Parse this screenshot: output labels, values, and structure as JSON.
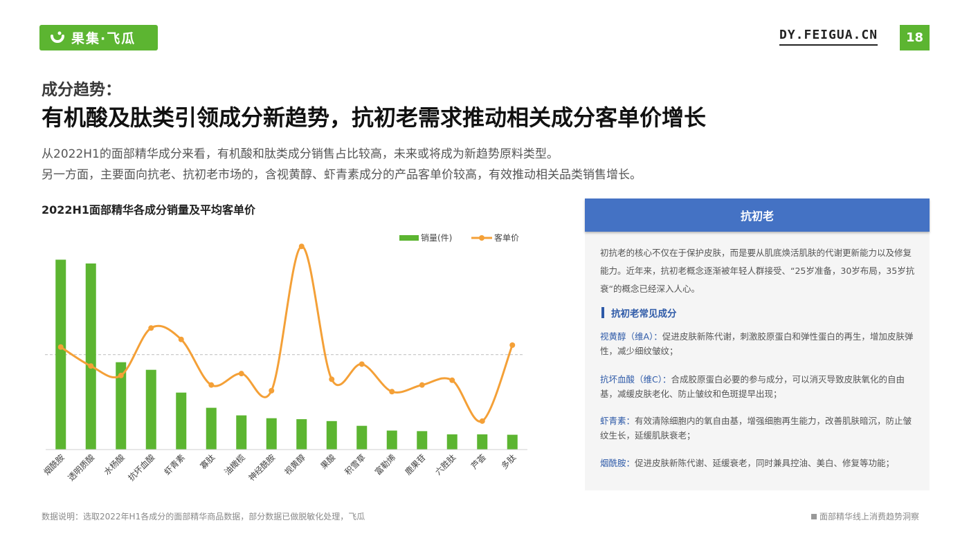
{
  "header": {
    "logo_text": "果集·飞瓜",
    "site_url": "DY.FEIGUA.CN",
    "page_number": "18",
    "brand_color": "#5cb531"
  },
  "heading": {
    "label": "成分趋势：",
    "title": "有机酸及肽类引领成分新趋势，抗初老需求推动相关成分客单价增长"
  },
  "description": [
    "从2022H1的面部精华成分来看，有机酸和肽类成分销售占比较高，未来或将成为新趋势原料类型。",
    "另一方面，主要面向抗老、抗初老市场的，含视黄醇、虾青素成分的产品客单价较高，有效推动相关品类销售增长。"
  ],
  "chart_title": "2022H1面部精华各成分销量及平均客单价",
  "chart_data": {
    "type": "bar",
    "categories": [
      "烟酰胺",
      "透明质酸",
      "水杨酸",
      "抗坏血酸",
      "虾青素",
      "寡肽",
      "油橄榄",
      "神经酰胺",
      "视黄醇",
      "果酸",
      "积雪草",
      "富勒烯",
      "鹿果苷",
      "六胜肽",
      "芦荟",
      "多肽"
    ],
    "series": [
      {
        "name": "销量(件)",
        "type": "bar",
        "color": "#5cb531",
        "values": [
          100,
          98,
          46,
          42,
          30,
          22,
          18,
          16.5,
          16,
          15,
          12.5,
          10,
          9.7,
          8,
          8,
          7.8
        ]
      },
      {
        "name": "客单价",
        "type": "line",
        "color": "#f4a037",
        "values": [
          54,
          44,
          39,
          64,
          58,
          34,
          40,
          31,
          107,
          37,
          45,
          30.5,
          34,
          36.5,
          15,
          55
        ]
      }
    ],
    "reference_line": 50,
    "ylim": [
      0,
      110
    ],
    "legend_position": "top-right",
    "grid": false
  },
  "footnote": "数据说明：选取2022年H1各成分的面部精华商品数据，部分数据已做脱敏化处理，飞瓜",
  "footer_right": "面部精华线上消费趋势洞察",
  "panel": {
    "header": "抗初老",
    "intro": "初抗老的核心不仅在于保护皮肤，而是要从肌底焕活肌肤的代谢更新能力以及修复能力。近年来，抗初老概念逐渐被年轻人群接受、“25岁准备，30岁布局，35岁抗衰“的概念已经深入人心。",
    "subheading": "抗初老常见成分",
    "ingredients": [
      {
        "name": "视黄醇（维A）：",
        "desc": "促进皮肤新陈代谢，刺激胶原蛋白和弹性蛋白的再生，增加皮肤弹性，减少细纹皱纹；"
      },
      {
        "name": "抗坏血酸（维C）：",
        "desc": "合成胶原蛋白必要的参与成分，可以消灭导致皮肤氧化的自由基，减缓皮肤老化、防止皱纹和色斑提早出现；"
      },
      {
        "name": "虾青素：",
        "desc": "有效清除细胞内的氧自由基，增强细胞再生能力，改善肌肤暗沉，防止皱纹生长，延缓肌肤衰老；"
      },
      {
        "name": "烟酰胺：",
        "desc": "促进皮肤新陈代谢、延缓衰老，同时兼具控油、美白、修复等功能；"
      }
    ]
  }
}
